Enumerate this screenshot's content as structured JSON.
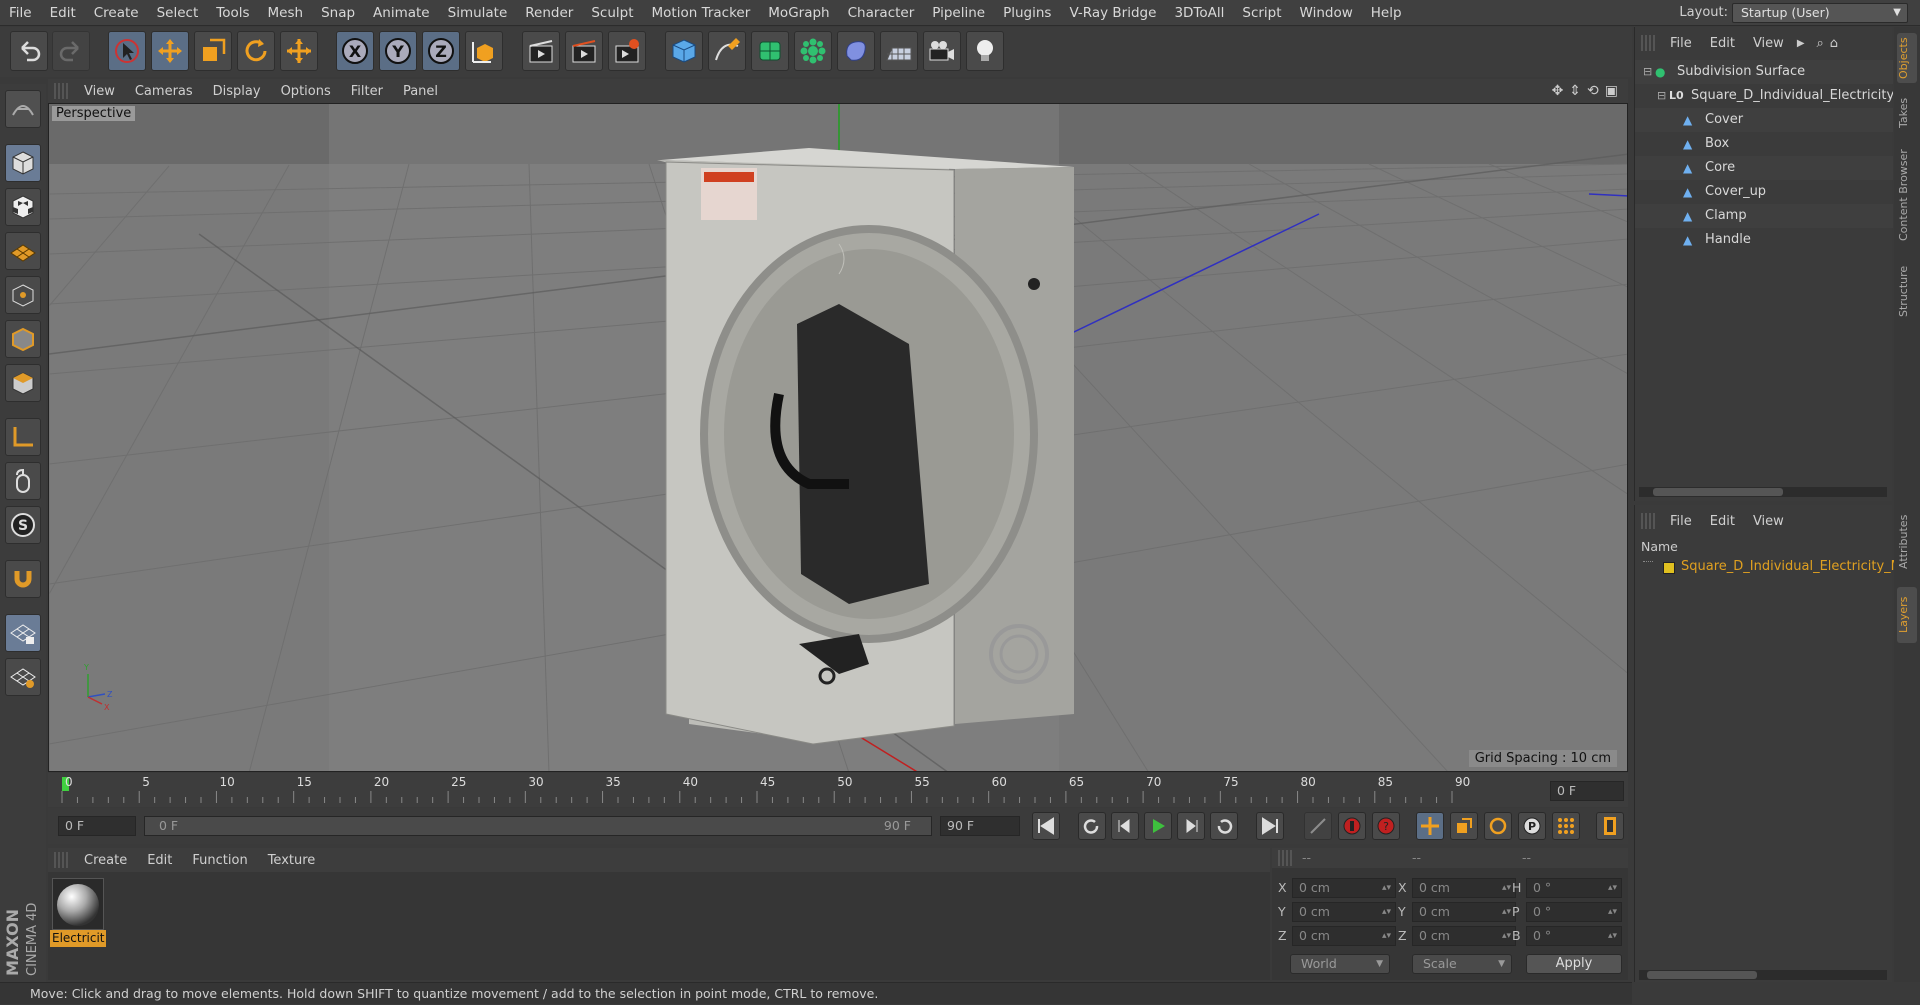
{
  "menubar": {
    "items": [
      "File",
      "Edit",
      "Create",
      "Select",
      "Tools",
      "Mesh",
      "Snap",
      "Animate",
      "Simulate",
      "Render",
      "Sculpt",
      "Motion Tracker",
      "MoGraph",
      "Character",
      "Pipeline",
      "Plugins",
      "V-Ray Bridge",
      "3DToAll",
      "Script",
      "Window",
      "Help"
    ],
    "layout_label": "Layout:",
    "layout_value": "Startup (User)"
  },
  "toolbar": {
    "icons": [
      "undo-icon",
      "redo-icon",
      "select-arrow-icon",
      "move-icon",
      "scale-icon",
      "rotate-icon",
      "transform-icon",
      "x-axis-icon",
      "y-axis-icon",
      "z-axis-icon",
      "coordinate-system-icon",
      "render-view-icon",
      "render-picture-queue-icon",
      "render-settings-icon",
      "cube-primitive-icon",
      "pen-spline-icon",
      "subdivision-icon",
      "cloner-icon",
      "deformer-icon",
      "floor-scene-icon",
      "camera-icon",
      "light-bulb-icon"
    ],
    "axis_x": "X",
    "axis_y": "Y",
    "axis_z": "Z"
  },
  "viewport": {
    "menu": [
      "View",
      "Cameras",
      "Display",
      "Options",
      "Filter",
      "Panel"
    ],
    "label": "Perspective",
    "grid_spacing": "Grid Spacing : 10 cm"
  },
  "timeline": {
    "ticks": [
      "0",
      "5",
      "10",
      "15",
      "20",
      "25",
      "30",
      "35",
      "40",
      "45",
      "50",
      "55",
      "60",
      "65",
      "70",
      "75",
      "80",
      "85",
      "90"
    ],
    "current_frame": "0 F",
    "start_frame": "0 F",
    "range_start": "0 F",
    "range_end": "90 F",
    "end_frame": "90 F"
  },
  "materials": {
    "menu": [
      "Create",
      "Edit",
      "Function",
      "Texture"
    ],
    "items": [
      {
        "name": "Electricit"
      }
    ]
  },
  "coordinates": {
    "headers": [
      "--",
      "--",
      "--"
    ],
    "rows": [
      {
        "a": "X",
        "pos": "0 cm",
        "b": "X",
        "size": "0 cm",
        "c": "H",
        "rot": "0 °"
      },
      {
        "a": "Y",
        "pos": "0 cm",
        "b": "Y",
        "size": "0 cm",
        "c": "P",
        "rot": "0 °"
      },
      {
        "a": "Z",
        "pos": "0 cm",
        "b": "Z",
        "size": "0 cm",
        "c": "B",
        "rot": "0 °"
      }
    ],
    "mode_world": "World",
    "mode_scale": "Scale",
    "apply": "Apply"
  },
  "objects": {
    "menu": [
      "File",
      "Edit",
      "View"
    ],
    "tree": [
      {
        "name": "Subdivision Surface",
        "level": 0,
        "icon": "subdivision-icon"
      },
      {
        "name": "Square_D_Individual_Electricity_M",
        "level": 1,
        "icon": "null-object-icon"
      },
      {
        "name": "Cover",
        "level": 2,
        "icon": "polygon-object-icon"
      },
      {
        "name": "Box",
        "level": 2,
        "icon": "polygon-object-icon"
      },
      {
        "name": "Core",
        "level": 2,
        "icon": "polygon-object-icon"
      },
      {
        "name": "Cover_up",
        "level": 2,
        "icon": "polygon-object-icon"
      },
      {
        "name": "Clamp",
        "level": 2,
        "icon": "polygon-object-icon"
      },
      {
        "name": "Handle",
        "level": 2,
        "icon": "polygon-object-icon"
      }
    ]
  },
  "layers": {
    "menu": [
      "File",
      "Edit",
      "View"
    ],
    "column_name": "Name",
    "items": [
      {
        "name": "Square_D_Individual_Electricity_M",
        "color": "#e0c020"
      }
    ]
  },
  "side_tabs": [
    "Objects",
    "Takes",
    "Content Browser",
    "Structure",
    "Attributes",
    "Layers"
  ],
  "brand": {
    "line1": "MAXON",
    "line2": "CINEMA 4D"
  },
  "status": "Move: Click and drag to move elements. Hold down SHIFT to quantize movement / add to the selection in point mode, CTRL to remove.",
  "colors": {
    "accent": "#e09a28",
    "selection": "#5b6e86",
    "play_green": "#3ec03e"
  }
}
